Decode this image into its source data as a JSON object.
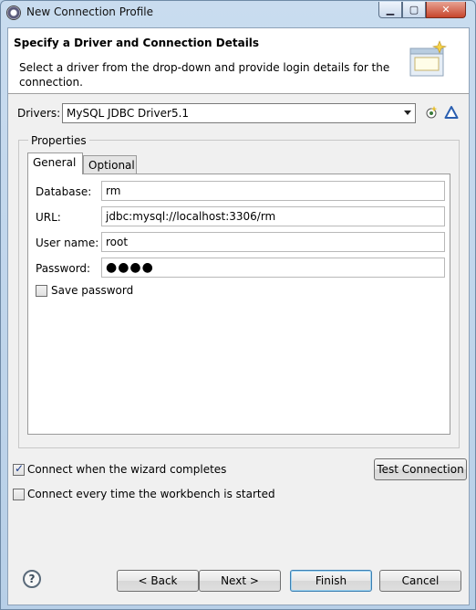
{
  "window": {
    "title": "New Connection Profile",
    "minimize_icon": "minimize-icon",
    "maximize_icon": "maximize-icon",
    "close_icon": "close-icon"
  },
  "header": {
    "title": "Specify a Driver and Connection Details",
    "description": "Select a driver from the drop-down and provide login details for the connection."
  },
  "drivers": {
    "label": "Drivers:",
    "selected": "MySQL JDBC Driver5.1",
    "new_driver_icon": "new-driver-icon",
    "edit_driver_icon": "edit-driver-icon"
  },
  "properties": {
    "legend": "Properties",
    "tabs": [
      "General",
      "Optional"
    ],
    "active_tab": "General",
    "fields": {
      "database": {
        "label": "Database:",
        "value": "rm"
      },
      "url": {
        "label": "URL:",
        "value": "jdbc:mysql://localhost:3306/rm"
      },
      "username": {
        "label": "User name:",
        "value": "root"
      },
      "password": {
        "label": "Password:",
        "value": "●●●●"
      }
    },
    "save_password": {
      "label": "Save password",
      "checked": false
    }
  },
  "options": {
    "connect_on_complete": {
      "label": "Connect when the wizard completes",
      "checked": true
    },
    "connect_on_start": {
      "label": "Connect every time the workbench is started",
      "checked": false
    },
    "test_connection": "Test Connection"
  },
  "footer": {
    "help_icon": "?",
    "back": "< Back",
    "next": "Next >",
    "finish": "Finish",
    "cancel": "Cancel"
  }
}
